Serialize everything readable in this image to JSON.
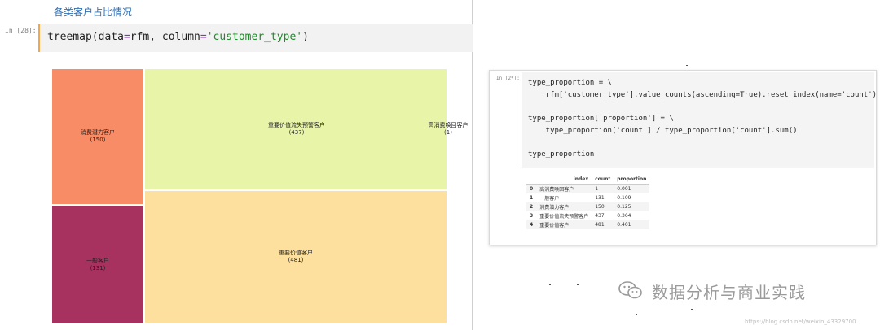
{
  "left": {
    "heading": "各类客户占比情况",
    "cell": {
      "prompt": "In [28]:",
      "code_fn": "treemap",
      "code_arg1": "data",
      "code_val1": "rfm",
      "code_arg2": "column",
      "code_val2": "'customer_type'"
    }
  },
  "treemap": {
    "tiles": [
      {
        "label": "消费潜力客户",
        "count": "(150)",
        "color": "#f78c66"
      },
      {
        "label": "一般客户",
        "count": "(131)",
        "color": "#a8325f"
      },
      {
        "label": "重要价值流失预警客户",
        "count": "(437)",
        "color": "#e8f5a8"
      },
      {
        "label": "高消费唤回客户",
        "count": "(1)",
        "color": "#e8f5a8"
      },
      {
        "label": "重要价值客户",
        "count": "(481)",
        "color": "#fde09d"
      }
    ]
  },
  "right": {
    "cell": {
      "prompt": "In [2*]:",
      "lines": [
        "type_proportion = \\",
        "    rfm['customer_type'].value_counts(ascending=True).reset_index(name='count')",
        "type_proportion['proportion'] = \\",
        "    type_proportion['count'] / type_proportion['count'].sum()",
        "type_proportion"
      ]
    },
    "table": {
      "headers": [
        "",
        "index",
        "count",
        "proportion"
      ],
      "rows": [
        [
          "0",
          "高消费唤回客户",
          "1",
          "0.001"
        ],
        [
          "1",
          "一般客户",
          "131",
          "0.109"
        ],
        [
          "2",
          "消费潜力客户",
          "150",
          "0.125"
        ],
        [
          "3",
          "重要价值流失预警客户",
          "437",
          "0.364"
        ],
        [
          "4",
          "重要价值客户",
          "481",
          "0.401"
        ]
      ]
    }
  },
  "watermark": {
    "title": "数据分析与商业实践",
    "url": "https://blog.csdn.net/weixin_43329700"
  }
}
